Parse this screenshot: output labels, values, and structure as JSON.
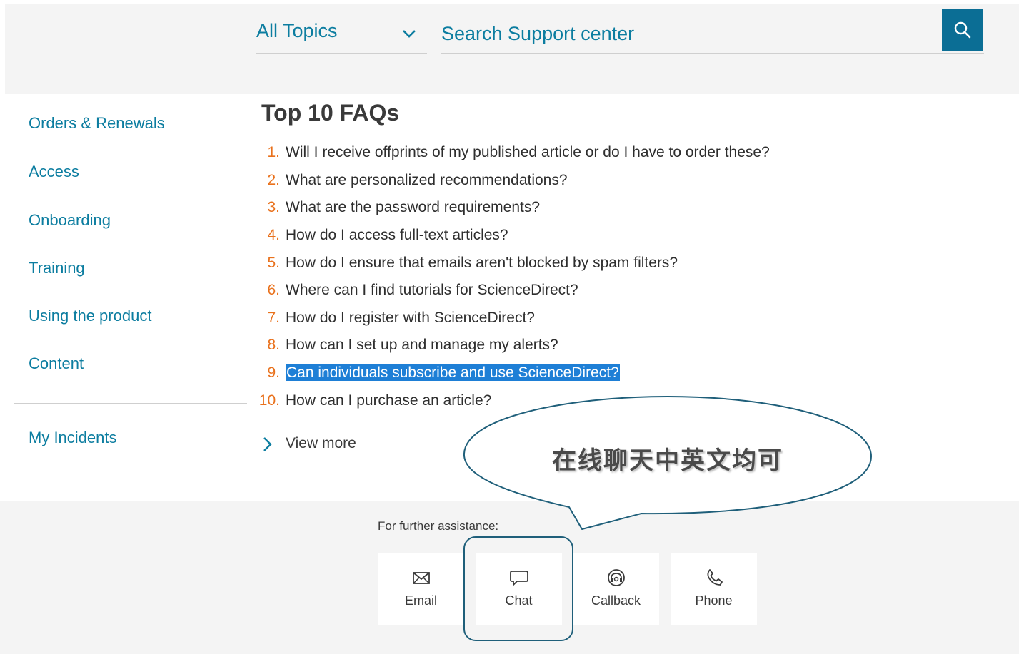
{
  "header": {
    "topic_select": {
      "selected": "All Topics"
    },
    "search": {
      "placeholder": "Search Support center"
    }
  },
  "sidebar": {
    "items": [
      {
        "label": "Orders & Renewals"
      },
      {
        "label": "Access"
      },
      {
        "label": "Onboarding"
      },
      {
        "label": "Training"
      },
      {
        "label": "Using the product"
      },
      {
        "label": "Content"
      }
    ],
    "incidents_label": "My Incidents"
  },
  "faq": {
    "title": "Top 10 FAQs",
    "items": [
      {
        "num": "1.",
        "text": "Will I receive offprints of my published article or do I have to order these?"
      },
      {
        "num": "2.",
        "text": "What are personalized recommendations?"
      },
      {
        "num": "3.",
        "text": "What are the password requirements?"
      },
      {
        "num": "4.",
        "text": "How do I access full-text articles?"
      },
      {
        "num": "5.",
        "text": "How do I ensure that emails aren't blocked by spam filters?"
      },
      {
        "num": "6.",
        "text": "Where can I find tutorials for ScienceDirect?"
      },
      {
        "num": "7.",
        "text": "How do I register with ScienceDirect?"
      },
      {
        "num": "8.",
        "text": "How can I set up and manage my alerts?"
      },
      {
        "num": "9.",
        "text": "Can individuals subscribe and use ScienceDirect?",
        "selected": true
      },
      {
        "num": "10.",
        "text": "How can I purchase an article?"
      }
    ],
    "view_more": "View more"
  },
  "footer": {
    "assist_label": "For further assistance:",
    "contacts": [
      {
        "label": "Email",
        "icon": "envelope-icon"
      },
      {
        "label": "Chat",
        "icon": "chat-bubble-icon"
      },
      {
        "label": "Callback",
        "icon": "headset-icon"
      },
      {
        "label": "Phone",
        "icon": "phone-icon"
      }
    ]
  },
  "annotation": {
    "callout_text": "在线聊天中英文均可"
  },
  "colors": {
    "link": "#0c7da0",
    "accent_button": "#0b6e95",
    "faq_number": "#e9711c",
    "selection": "#1e7fd6",
    "annotation_stroke": "#1f5f7a"
  }
}
